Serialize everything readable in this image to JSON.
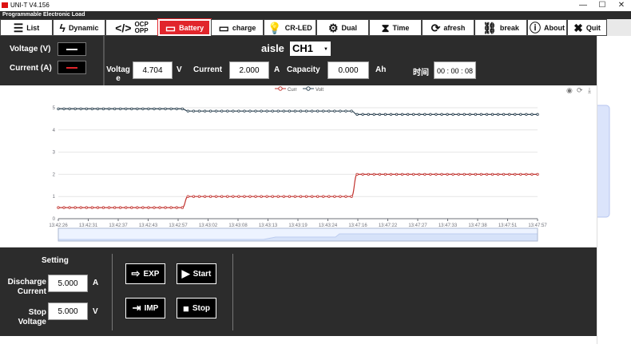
{
  "window": {
    "title": "UNI-T V4.156",
    "minimize": "—",
    "maximize": "☐",
    "close": "✕"
  },
  "app": {
    "subtitle": "Programmable Electronic Load"
  },
  "toolbar": [
    {
      "label": "List",
      "icon": "list-icon",
      "glyph": "☰"
    },
    {
      "label": "Dynamic",
      "icon": "lightning-icon",
      "glyph": "ϟ"
    },
    {
      "label": "OCP OPP",
      "icon": "code-icon",
      "glyph": "</>"
    },
    {
      "label": "Battery",
      "icon": "battery-icon",
      "glyph": "▭",
      "active": true
    },
    {
      "label": "charge",
      "icon": "battery-charge-icon",
      "glyph": "▭"
    },
    {
      "label": "CR-LED",
      "icon": "bulb-icon",
      "glyph": "💡"
    },
    {
      "label": "Dual",
      "icon": "gears-icon",
      "glyph": "⚙"
    },
    {
      "label": "Time",
      "icon": "hourglass-icon",
      "glyph": "⧗"
    },
    {
      "label": "afresh",
      "icon": "refresh-icon",
      "glyph": "⟳"
    },
    {
      "label": "break",
      "icon": "unlink-icon",
      "glyph": "⛓"
    },
    {
      "label": "About",
      "icon": "info-icon",
      "glyph": "ⓘ"
    },
    {
      "label": "Quit",
      "icon": "close-box-icon",
      "glyph": "✖"
    }
  ],
  "legend_panel": {
    "voltage_label": "Voltage (V)",
    "current_label": "Current (A)",
    "voltage_color": "#ffffff",
    "current_color": "#e1252b"
  },
  "channel": {
    "label": "aisle",
    "value": "CH1"
  },
  "readings": {
    "voltage_label": "Voltag e",
    "voltage_value": "4.704",
    "voltage_unit": "V",
    "current_label": "Current",
    "current_value": "2.000",
    "current_unit": "A",
    "capacity_label": "Capacity",
    "capacity_value": "0.000",
    "capacity_unit": "Ah",
    "time_label": "时间",
    "time_value": "00 : 00 : 08"
  },
  "chart_data": {
    "type": "line",
    "legend": [
      "Curr",
      "Volt"
    ],
    "x_tick_labels": [
      "13:42:26",
      "13:42:31",
      "13:42:37",
      "13:42:43",
      "13:42:57",
      "13:43:02",
      "13:43:08",
      "13:43:13",
      "13:43:19",
      "13:43:24",
      "13:47:16",
      "13:47:22",
      "13:47:27",
      "13:47:33",
      "13:47:38",
      "13:47:51",
      "13:47:57"
    ],
    "ylim": [
      0,
      5
    ],
    "y_ticks": [
      0,
      1,
      2,
      3,
      4,
      5
    ],
    "series": [
      {
        "name": "Curr",
        "color": "#c23531",
        "values": [
          0.5,
          0.5,
          0.5,
          0.5,
          0.5,
          0.5,
          0.5,
          0.5,
          0.5,
          0.5,
          0.5,
          0.5,
          0.5,
          0.5,
          0.5,
          0.5,
          0.5,
          0.5,
          0.5,
          0.5,
          0.5,
          0.5,
          0.5,
          1.0,
          1.0,
          1.0,
          1.0,
          1.0,
          1.0,
          1.0,
          1.0,
          1.0,
          1.0,
          1.0,
          1.0,
          1.0,
          1.0,
          1.0,
          1.0,
          1.0,
          1.0,
          1.0,
          1.0,
          1.0,
          1.0,
          1.0,
          1.0,
          1.0,
          1.0,
          1.0,
          1.0,
          1.0,
          1.0,
          2.0,
          2.0,
          2.0,
          2.0,
          2.0,
          2.0,
          2.0,
          2.0,
          2.0,
          2.0,
          2.0,
          2.0,
          2.0,
          2.0,
          2.0,
          2.0,
          2.0,
          2.0,
          2.0,
          2.0,
          2.0,
          2.0,
          2.0,
          2.0,
          2.0,
          2.0,
          2.0,
          2.0,
          2.0,
          2.0,
          2.0,
          2.0,
          2.0
        ]
      },
      {
        "name": "Volt",
        "color": "#2f4554",
        "values": [
          4.95,
          4.95,
          4.95,
          4.95,
          4.95,
          4.95,
          4.95,
          4.95,
          4.95,
          4.95,
          4.95,
          4.95,
          4.95,
          4.95,
          4.95,
          4.95,
          4.95,
          4.95,
          4.95,
          4.95,
          4.95,
          4.95,
          4.95,
          4.85,
          4.85,
          4.85,
          4.85,
          4.85,
          4.85,
          4.85,
          4.85,
          4.85,
          4.85,
          4.85,
          4.85,
          4.85,
          4.85,
          4.85,
          4.85,
          4.85,
          4.85,
          4.85,
          4.85,
          4.85,
          4.85,
          4.85,
          4.85,
          4.85,
          4.85,
          4.85,
          4.85,
          4.85,
          4.85,
          4.7,
          4.7,
          4.7,
          4.7,
          4.7,
          4.7,
          4.7,
          4.7,
          4.7,
          4.7,
          4.7,
          4.7,
          4.7,
          4.7,
          4.7,
          4.7,
          4.7,
          4.7,
          4.7,
          4.7,
          4.7,
          4.7,
          4.7,
          4.7,
          4.7,
          4.7,
          4.7,
          4.7,
          4.7,
          4.7,
          4.7,
          4.7,
          4.7
        ]
      }
    ]
  },
  "setting": {
    "title": "Setting",
    "discharge_label": "Discharge Current",
    "discharge_value": "5.000",
    "discharge_unit": "A",
    "stop_label": "Stop Voltage",
    "stop_value": "5.000",
    "stop_unit": "V"
  },
  "actions": {
    "exp_label": "EXP",
    "start_label": "Start",
    "imp_label": "IMP",
    "stop_label": "Stop"
  }
}
